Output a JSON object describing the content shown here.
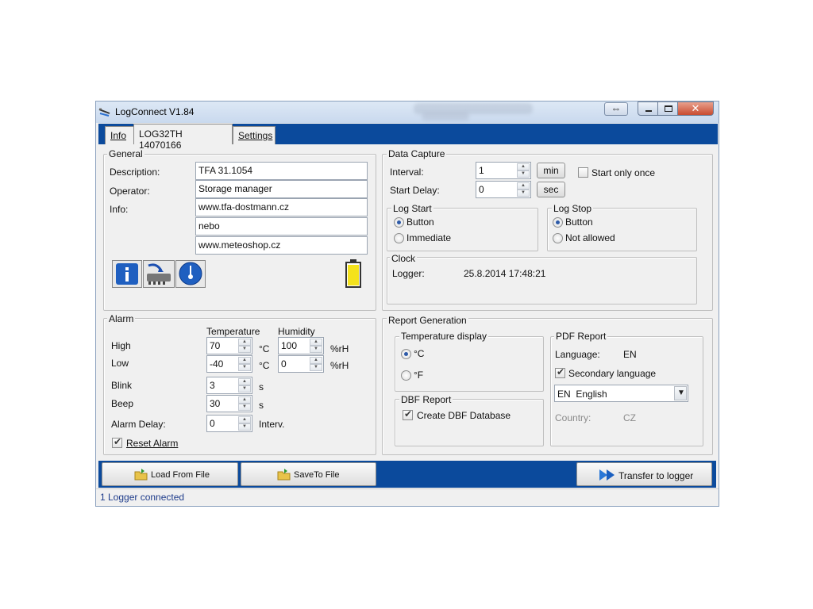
{
  "window": {
    "title": "LogConnect V1.84"
  },
  "tabs": [
    {
      "label": "Info"
    },
    {
      "label": "LOG32TH 14070166"
    },
    {
      "label": "Settings"
    }
  ],
  "general": {
    "title": "General",
    "description_label": "Description:",
    "description_value": "TFA 31.1054",
    "operator_label": "Operator:",
    "operator_value": " Storage manager",
    "info_label": "Info:",
    "info_lines": [
      "www.tfa-dostmann.cz",
      " nebo",
      "www.meteoshop.cz"
    ],
    "icons": [
      "info-icon",
      "load-firmware-icon",
      "temperature-probe-icon",
      "battery-icon"
    ]
  },
  "data_capture": {
    "title": "Data Capture",
    "interval_label": "Interval:",
    "interval_value": "1",
    "interval_unit": "min",
    "start_delay_label": "Start Delay:",
    "start_delay_value": "0",
    "start_delay_unit": "sec",
    "start_only_once_label": "Start only once",
    "start_only_once_checked": false,
    "log_start": {
      "title": "Log Start",
      "options": [
        "Button",
        "Immediate"
      ],
      "selected": "Button"
    },
    "log_stop": {
      "title": "Log Stop",
      "options": [
        "Button",
        "Not allowed"
      ],
      "selected": "Button"
    },
    "clock": {
      "title": "Clock",
      "logger_label": "Logger:",
      "logger_value": "25.8.2014 17:48:21"
    }
  },
  "alarm": {
    "title": "Alarm",
    "temperature_header": "Temperature",
    "humidity_header": "Humidity",
    "high_label": "High",
    "low_label": "Low",
    "high_temp": "70",
    "low_temp": "-40",
    "temp_unit": "°C",
    "high_hum": "100",
    "low_hum": "0",
    "hum_unit": "%rH",
    "blink_label": "Blink",
    "blink_value": "3",
    "beep_label": "Beep",
    "beep_value": "30",
    "seconds_unit": "s",
    "alarm_delay_label": "Alarm Delay:",
    "alarm_delay_value": "0",
    "alarm_delay_unit": "Interv.",
    "reset_alarm_label": "Reset Alarm",
    "reset_alarm_checked": true
  },
  "report": {
    "title": "Report Generation",
    "temp_display": {
      "title": "Temperature display",
      "options": [
        "°C",
        "°F"
      ],
      "selected": "°C"
    },
    "dbf": {
      "title": "DBF Report",
      "create_label": "Create DBF Database",
      "create_checked": true
    },
    "pdf": {
      "title": "PDF Report",
      "language_label": "Language:",
      "language_value": "EN",
      "secondary_label": "Secondary language",
      "secondary_checked": true,
      "secondary_select": "EN  English",
      "country_label": "Country:",
      "country_value": "CZ"
    }
  },
  "buttons": {
    "load": "Load From File",
    "save": "SaveTo File",
    "transfer": "Transfer to logger"
  },
  "status": {
    "text": "1 Logger connected"
  },
  "colors": {
    "accent": "#0b4a9c",
    "status_text": "#1d3b8a"
  }
}
